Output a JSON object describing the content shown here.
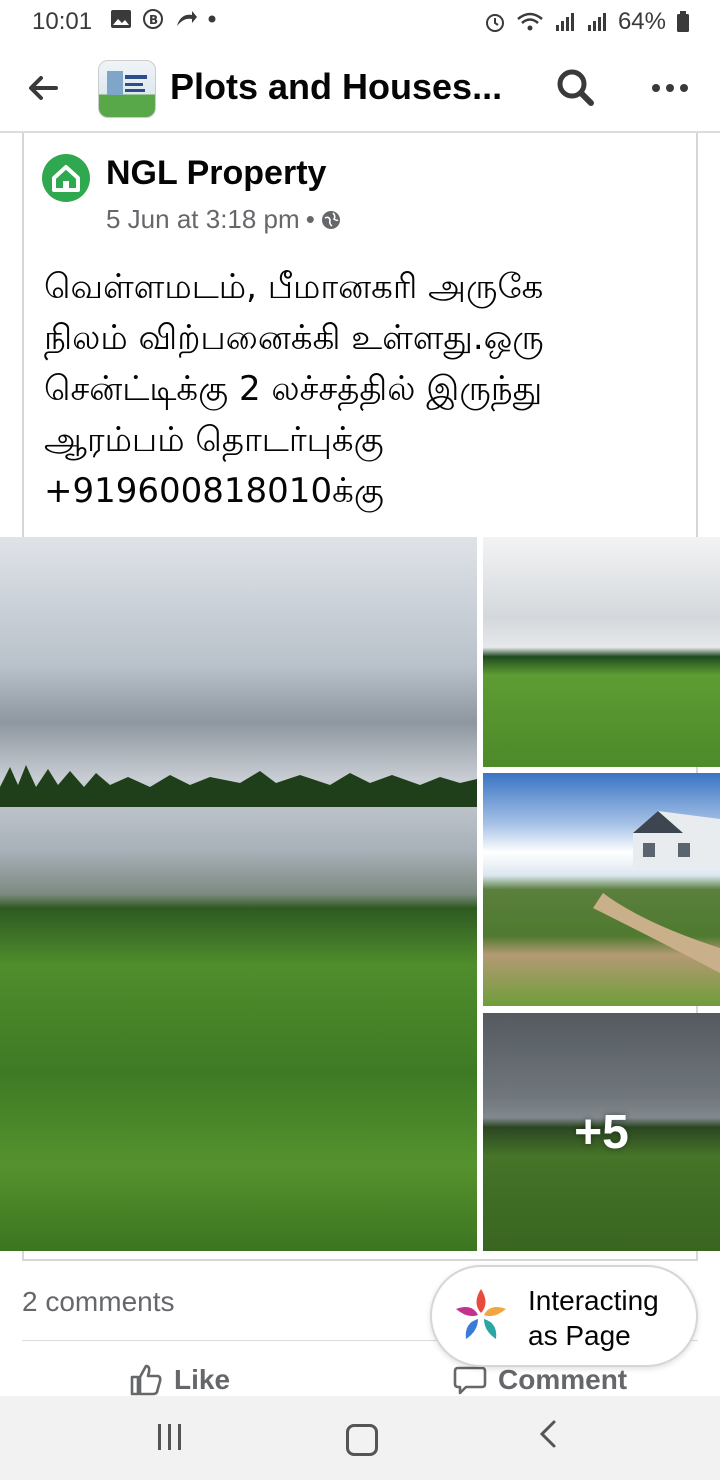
{
  "status_bar": {
    "time": "10:01",
    "battery": "64%"
  },
  "app_bar": {
    "title": "Plots and Houses..."
  },
  "post": {
    "author": "NGL Property",
    "timestamp": "5 Jun at 3:18 pm",
    "separator": "•",
    "text_lines": [
      "வெள்ளமடம், பீமானகரி அருகே",
      "நிலம் விற்பனைக்கி உள்ளது.ஒரு",
      "சென்ட்டிக்கு 2 லச்சத்தில் இருந்து",
      "ஆரம்பம் தொடர்புக்கு",
      "+919600818010க்கு"
    ],
    "more_photos": "+5"
  },
  "footer": {
    "comments": "2 comments",
    "like_label": "Like",
    "comment_label": "Comment"
  },
  "interacting_pill": {
    "line1": "Interacting",
    "line2": "as Page"
  },
  "icons": [
    "back-arrow-icon",
    "search-icon",
    "more-icon",
    "globe-icon",
    "like-icon",
    "comment-icon",
    "home-icon"
  ]
}
